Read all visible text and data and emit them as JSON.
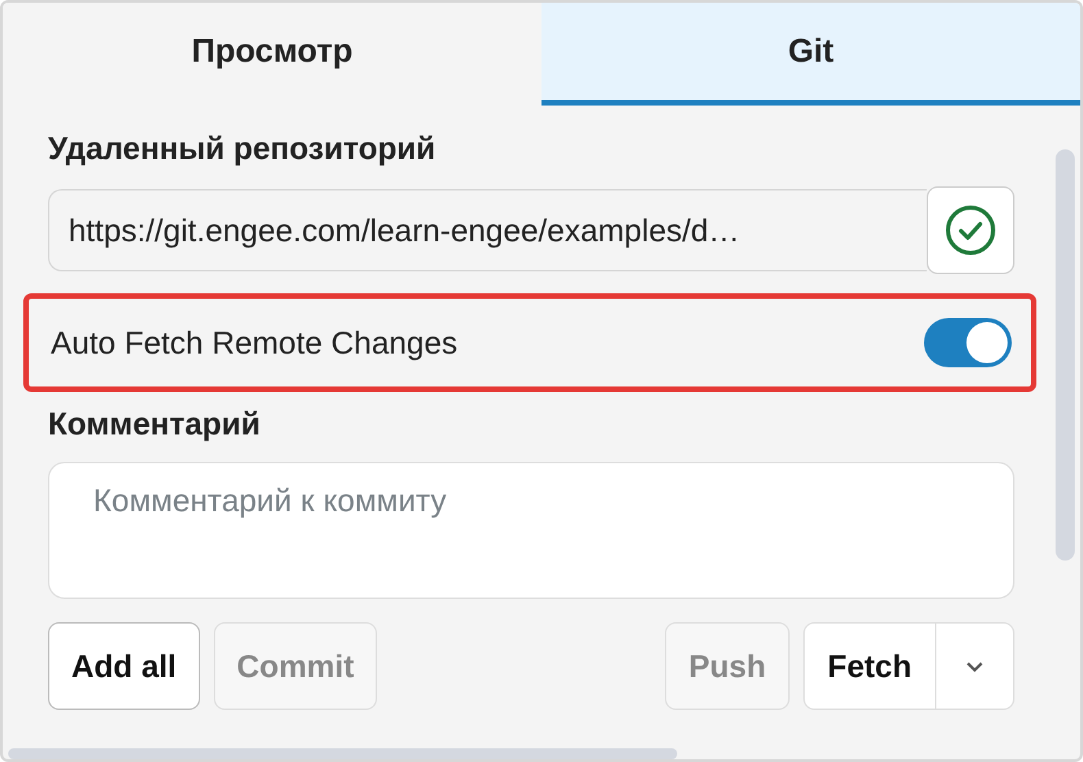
{
  "tabs": [
    {
      "label": "Просмотр",
      "selected": false
    },
    {
      "label": "Git",
      "selected": true
    }
  ],
  "remote": {
    "label": "Удаленный репозиторий",
    "value": "https://git.engee.com/learn-engee/examples/d…",
    "verified": true
  },
  "auto_fetch": {
    "label": "Auto Fetch Remote Changes",
    "on": true,
    "highlighted": true
  },
  "comment": {
    "label": "Комментарий",
    "placeholder": "Комментарий к коммиту"
  },
  "left_buttons": [
    {
      "label": "Add all",
      "disabled": false
    },
    {
      "label": "Commit",
      "disabled": true
    }
  ],
  "push_button": {
    "label": "Push",
    "disabled": true
  },
  "fetch_button": {
    "label": "Fetch",
    "disabled": false
  }
}
